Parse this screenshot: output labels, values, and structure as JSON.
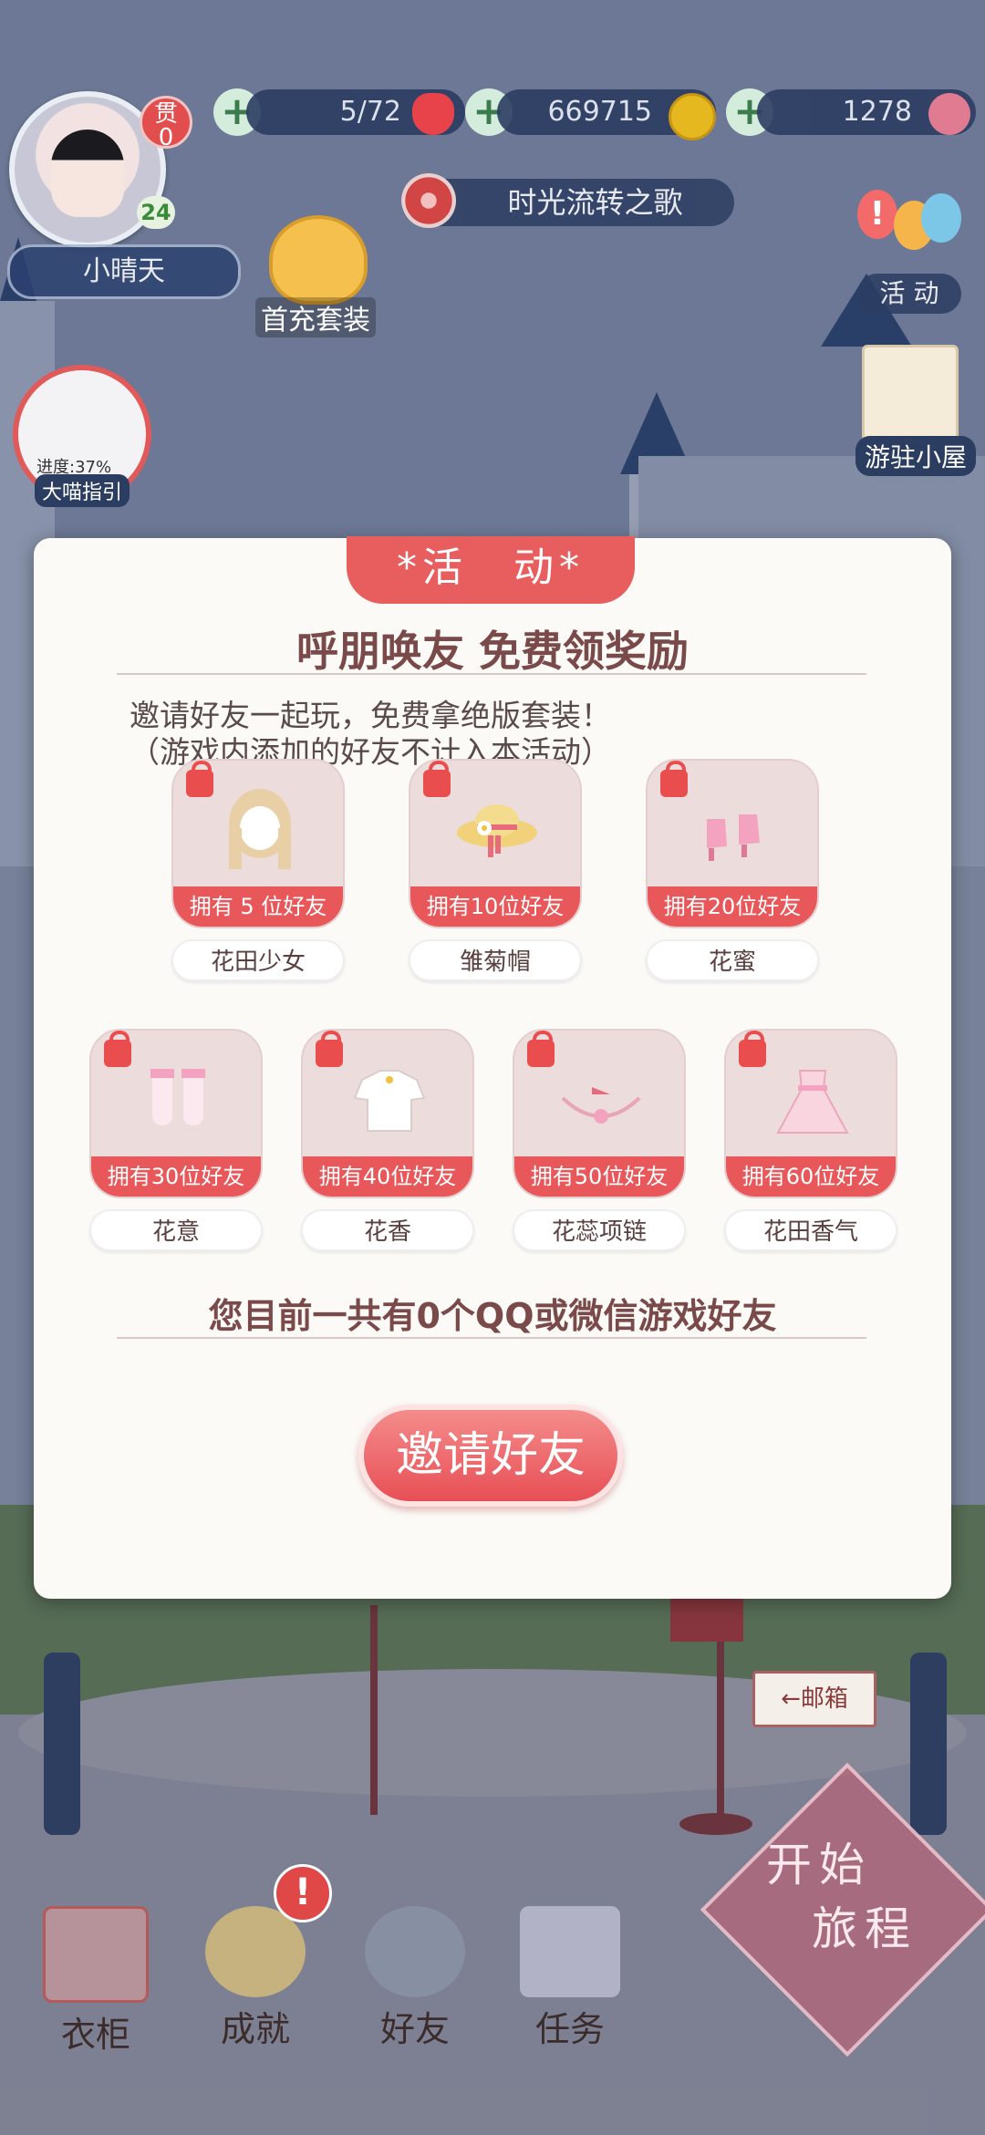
{
  "hud": {
    "player_name": "小晴天",
    "level": "24",
    "badge_top": "贯",
    "badge_count": "0",
    "stamina": "5/72",
    "coins": "669715",
    "gems": "1278",
    "event_song": "时光流转之歌",
    "first_charge": "首充套装",
    "activity_label": "活 动",
    "house_label": "游驻小屋",
    "guide_progress": "进度:37%",
    "guide_label": "大喵指引"
  },
  "modal": {
    "tab_label": "*活　动*",
    "title": "呼朋唤友 免费领奖励",
    "desc_line1": "邀请好友一起玩，免费拿绝版套装！",
    "desc_line2": "（游戏内添加的好友不计入本活动）",
    "rewards": [
      {
        "requirement": "拥有 5 位好友",
        "name": "花田少女"
      },
      {
        "requirement": "拥有10位好友",
        "name": "雏菊帽"
      },
      {
        "requirement": "拥有20位好友",
        "name": "花蜜"
      },
      {
        "requirement": "拥有30位好友",
        "name": "花意"
      },
      {
        "requirement": "拥有40位好友",
        "name": "花香"
      },
      {
        "requirement": "拥有50位好友",
        "name": "花蕊项链"
      },
      {
        "requirement": "拥有60位好友",
        "name": "花田香气"
      }
    ],
    "friend_count_text": "您目前一共有0个QQ或微信游戏好友",
    "invite_button": "邀请好友"
  },
  "scene": {
    "mailbox_sign": "←邮箱",
    "start_line1": "开始",
    "start_line2": "旅程"
  },
  "nav": {
    "items": [
      {
        "label": "衣柜",
        "icon": "wardrobe-icon"
      },
      {
        "label": "成就",
        "icon": "medal-icon"
      },
      {
        "label": "好友",
        "icon": "friends-icon"
      },
      {
        "label": "任务",
        "icon": "task-icon"
      }
    ],
    "alert_symbol": "!"
  },
  "colors": {
    "accent_red": "#e8585a",
    "modal_bg": "#fbfaf7",
    "title_brown": "#7a4a4a"
  }
}
